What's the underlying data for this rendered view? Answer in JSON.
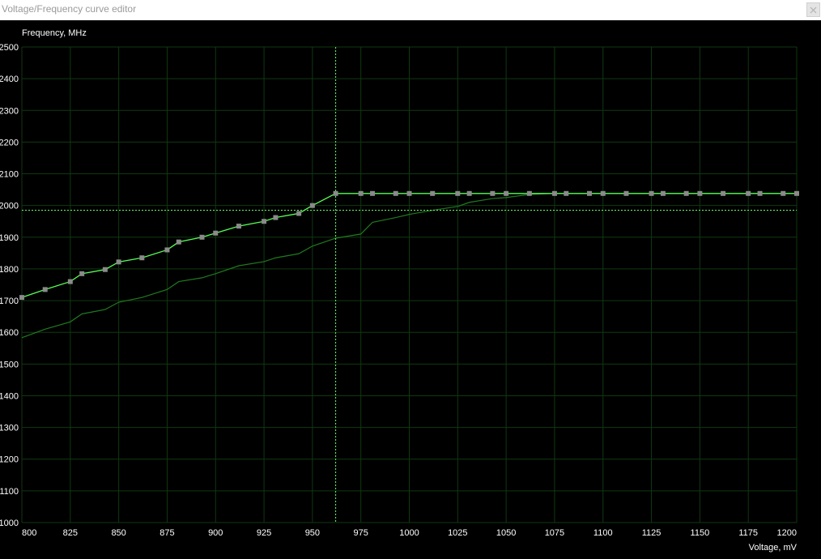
{
  "window": {
    "title": "Voltage/Frequency curve editor",
    "close_icon": "close-icon"
  },
  "colors": {
    "background": "#000000",
    "grid": "#103810",
    "curve": "#55ff55",
    "baseline_curve": "#1f7a1f",
    "crosshair": "#66ff66",
    "point": "#8a8a8a",
    "axis_text": "#ffffff"
  },
  "chart_data": {
    "type": "line",
    "ylabel": "Frequency, MHz",
    "xlabel": "Voltage, mV",
    "xlim": [
      800,
      1200
    ],
    "ylim": [
      1000,
      2500
    ],
    "x_ticks": [
      800,
      825,
      850,
      875,
      900,
      925,
      950,
      975,
      1000,
      1025,
      1050,
      1075,
      1100,
      1125,
      1150,
      1175,
      1200
    ],
    "y_ticks": [
      1000,
      1100,
      1200,
      1300,
      1400,
      1500,
      1600,
      1700,
      1800,
      1900,
      2000,
      2100,
      2200,
      2300,
      2400,
      2500
    ],
    "grid": true,
    "crosshair": {
      "x": 962,
      "y": 1985
    },
    "series": [
      {
        "role": "edited-curve",
        "x": [
          800,
          812,
          825,
          831,
          843,
          850,
          862,
          875,
          881,
          893,
          900,
          912,
          925,
          931,
          943,
          950,
          962,
          975,
          981,
          993,
          1000,
          1012,
          1025,
          1031,
          1043,
          1050,
          1062,
          1075,
          1081,
          1093,
          1100,
          1112,
          1125,
          1131,
          1143,
          1150,
          1162,
          1175,
          1181,
          1193,
          1200
        ],
        "y": [
          1710,
          1735,
          1760,
          1785,
          1798,
          1822,
          1835,
          1860,
          1885,
          1900,
          1913,
          1935,
          1950,
          1962,
          1975,
          2000,
          2038,
          2038,
          2038,
          2038,
          2038,
          2038,
          2038,
          2038,
          2038,
          2038,
          2038,
          2038,
          2038,
          2038,
          2038,
          2038,
          2038,
          2038,
          2038,
          2038,
          2038,
          2038,
          2038,
          2038,
          2038
        ]
      },
      {
        "role": "baseline-curve",
        "x": [
          800,
          812,
          825,
          831,
          843,
          850,
          862,
          875,
          881,
          893,
          900,
          912,
          925,
          931,
          943,
          950,
          962,
          975,
          981,
          993,
          1000,
          1012,
          1025,
          1031,
          1043,
          1050,
          1062,
          1075,
          1100,
          1125,
          1150,
          1175,
          1200
        ],
        "y": [
          1583,
          1610,
          1633,
          1658,
          1672,
          1695,
          1710,
          1735,
          1760,
          1772,
          1785,
          1810,
          1823,
          1835,
          1848,
          1872,
          1897,
          1910,
          1947,
          1962,
          1972,
          1985,
          1997,
          2010,
          2022,
          2025,
          2035,
          2038,
          2038,
          2038,
          2038,
          2038,
          2038
        ]
      }
    ]
  }
}
